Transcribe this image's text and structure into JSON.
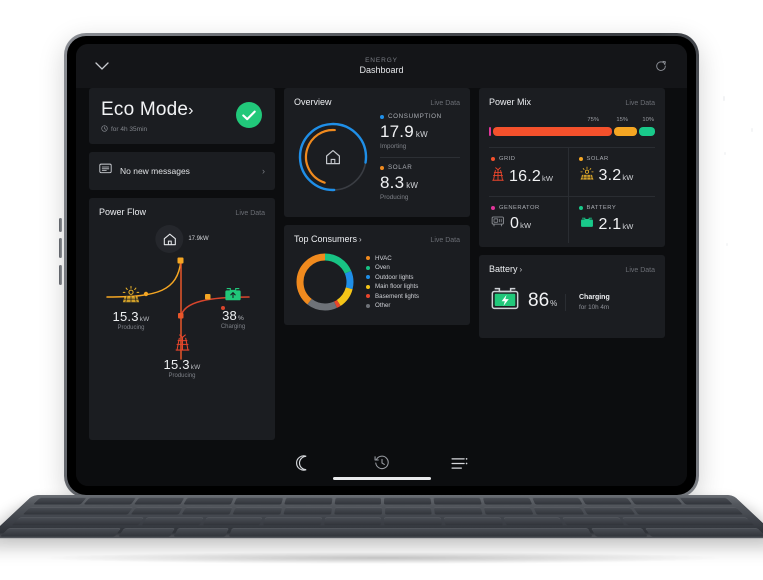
{
  "header": {
    "eyebrow": "ENERGY",
    "title": "Dashboard",
    "back_icon": "chevron-down-icon",
    "refresh_icon": "refresh-icon"
  },
  "eco": {
    "title": "Eco Mode",
    "chevron": "›",
    "duration": "for 4h 35min",
    "clock_icon": "clock-icon",
    "status_icon": "check-icon",
    "status_color": "#21c87a"
  },
  "messages": {
    "label": "No new messages",
    "icon": "message-icon",
    "chevron": "›"
  },
  "power_flow": {
    "title": "Power Flow",
    "live": "Live Data",
    "house": {
      "icon": "home-icon",
      "value": "17.9kW"
    },
    "nodes": [
      {
        "name": "solar",
        "icon": "solar-panel-icon",
        "value": "15.3",
        "unit": "kW",
        "caption": "Producing",
        "color": "#f0a92a"
      },
      {
        "name": "battery",
        "icon": "battery-icon",
        "value": "38",
        "unit": "%",
        "caption": "Charging",
        "color": "#21c87a"
      },
      {
        "name": "grid",
        "icon": "pylon-icon",
        "value": "15.3",
        "unit": "kW",
        "caption": "Producing",
        "color": "#e8452c"
      }
    ]
  },
  "overview": {
    "title": "Overview",
    "live": "Live Data",
    "center_icon": "home-icon",
    "stats": [
      {
        "key": "CONSUMPTION",
        "value": "17.9",
        "unit": "kW",
        "note": "Importing",
        "color": "#1f8fe8"
      },
      {
        "key": "SOLAR",
        "value": "8.3",
        "unit": "kW",
        "note": "Producing",
        "color": "#f08a1e"
      }
    ]
  },
  "top_consumers": {
    "title": "Top Consumers",
    "chevron": "›",
    "live": "Live Data",
    "legend": [
      {
        "label": "HVAC",
        "color": "#f08a1e",
        "value": 34
      },
      {
        "label": "Oven",
        "color": "#18c384",
        "value": 16
      },
      {
        "label": "Outdoor lights",
        "color": "#1f8fe8",
        "value": 9
      },
      {
        "label": "Main floor lights",
        "color": "#f5c518",
        "value": 10
      },
      {
        "label": "Basement lights",
        "color": "#e8452c",
        "value": 2
      },
      {
        "label": "Other",
        "color": "#6e7278",
        "value": 15
      }
    ]
  },
  "power_mix": {
    "title": "Power Mix",
    "live": "Live Data",
    "bar": [
      {
        "name": "generator",
        "percent": 1,
        "label": "",
        "color": "#e0359a"
      },
      {
        "name": "grid",
        "percent": 75,
        "label": "75%",
        "color": "#f4512c"
      },
      {
        "name": "solar",
        "percent": 15,
        "label": "15%",
        "color": "#f5a623"
      },
      {
        "name": "battery",
        "percent": 10,
        "label": "10%",
        "color": "#19c98a"
      }
    ],
    "cells": [
      {
        "key": "GRID",
        "icon": "pylon-icon",
        "value": "16.2",
        "unit": "kW",
        "color": "#f4512c"
      },
      {
        "key": "SOLAR",
        "icon": "solar-panel-icon",
        "value": "3.2",
        "unit": "kW",
        "color": "#f5a623"
      },
      {
        "key": "GENERATOR",
        "icon": "generator-icon",
        "value": "0",
        "unit": "kW",
        "color": "#e0359a"
      },
      {
        "key": "BATTERY",
        "icon": "battery-icon",
        "value": "2.1",
        "unit": "kW",
        "color": "#19c98a"
      }
    ]
  },
  "battery": {
    "title": "Battery",
    "chevron": "›",
    "live": "Live Data",
    "icon": "battery-bolt-icon",
    "percent": "86",
    "unit": "%",
    "status": "Charging",
    "duration": "for 10h 4m"
  },
  "bottom_nav": [
    {
      "name": "moon-icon",
      "label": ""
    },
    {
      "name": "history-icon",
      "label": ""
    },
    {
      "name": "list-icon",
      "label": ""
    }
  ],
  "chart_data": [
    {
      "type": "pie",
      "title": "Overview",
      "series": [
        {
          "name": "Consumption",
          "value": 17.9,
          "unit": "kW",
          "color": "#1f8fe8",
          "arc_fraction": 0.78
        },
        {
          "name": "Solar",
          "value": 8.3,
          "unit": "kW",
          "color": "#f08a1e",
          "arc_fraction": 0.46
        }
      ],
      "legend": [
        "CONSUMPTION",
        "SOLAR"
      ]
    },
    {
      "type": "pie",
      "title": "Top Consumers",
      "categories": [
        "HVAC",
        "Oven",
        "Outdoor lights",
        "Main floor lights",
        "Basement lights",
        "Other"
      ],
      "values": [
        34,
        16,
        9,
        10,
        2,
        15
      ],
      "colors": [
        "#f08a1e",
        "#18c384",
        "#1f8fe8",
        "#f5c518",
        "#e8452c",
        "#6e7278"
      ]
    },
    {
      "type": "bar",
      "title": "Power Mix",
      "categories": [
        "Generator",
        "Grid",
        "Solar",
        "Battery"
      ],
      "values": [
        0,
        75,
        15,
        10
      ],
      "ylabel": "%",
      "ylim": [
        0,
        100
      ],
      "colors": [
        "#e0359a",
        "#f4512c",
        "#f5a623",
        "#19c98a"
      ]
    }
  ]
}
